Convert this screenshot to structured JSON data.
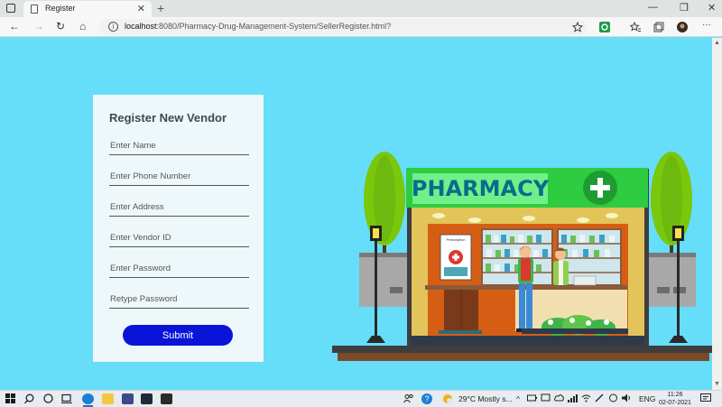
{
  "browser": {
    "tab_title": "Register",
    "tab_close": "✕",
    "new_tab": "+",
    "address": {
      "host": "localhost",
      "path": ":8080/Pharmacy-Drug-Management-System/SellerRegister.html?"
    },
    "info_icon": "i",
    "controls": {
      "minimize": "—",
      "restore": "❐",
      "close": "✕"
    },
    "nav": {
      "back": "←",
      "forward": "→",
      "refresh": "↻",
      "home": "⌂"
    }
  },
  "form": {
    "title": "Register New Vendor",
    "fields": [
      {
        "placeholder": "Enter Name"
      },
      {
        "placeholder": "Enter Phone Number"
      },
      {
        "placeholder": "Enter Address"
      },
      {
        "placeholder": "Enter Vendor ID"
      },
      {
        "placeholder": "Enter Password"
      },
      {
        "placeholder": "Retype Password"
      }
    ],
    "submit_label": "Submit"
  },
  "illustration": {
    "sign_text": "PHARMACY",
    "poster_title": "Prescription",
    "cross_icon": "+"
  },
  "taskbar": {
    "weather": "29°C  Mostly s...",
    "language": "ENG",
    "time": "11:26",
    "date": "02-07-2021"
  },
  "colors": {
    "page_bg": "#66ddf9",
    "submit_bg": "#0a14d8",
    "sign_green": "#2ecc40",
    "sign_text": "#0a6c8a"
  }
}
